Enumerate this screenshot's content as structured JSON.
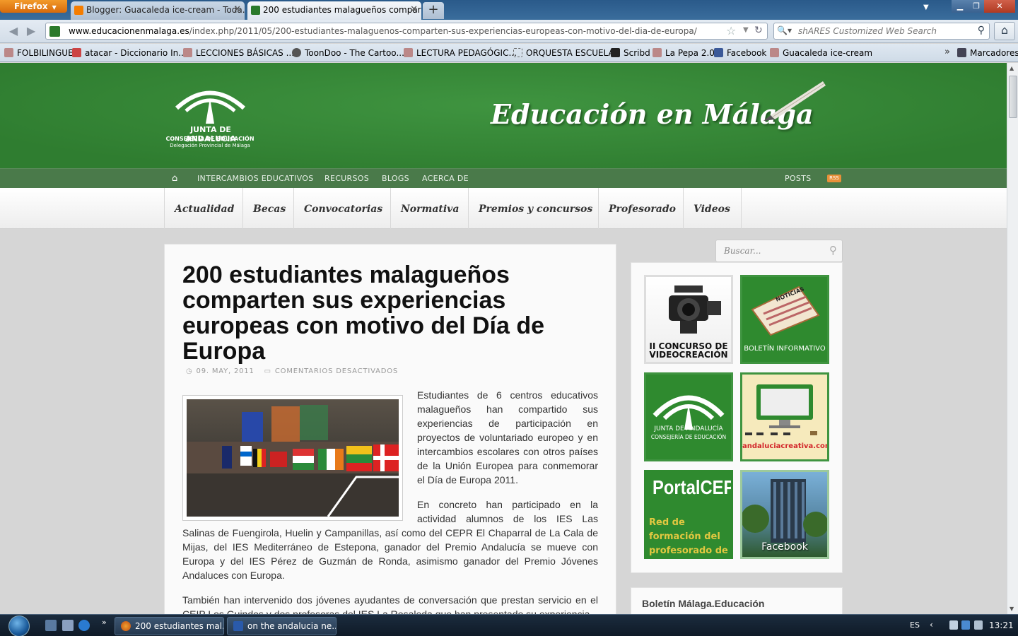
{
  "browser": {
    "menu_button": "Firefox",
    "tabs": [
      {
        "label": "Blogger: Guacaleda ice-cream - Toda...",
        "active": false
      },
      {
        "label": "200 estudiantes malagueños compart...",
        "active": true
      }
    ],
    "url_domain": "www.educacionenmalaga.es",
    "url_path": "/index.php/2011/05/200-estudiantes-malaguenos-comparten-sus-experiencias-europeas-con-motivo-del-dia-de-europa/",
    "search_placeholder": "shARES Customized Web Search",
    "bookmarks": [
      "FOLBILINGUE",
      "atacar - Diccionario In...",
      "LECCIONES BÁSICAS ...",
      "ToonDoo - The Cartoo...",
      "LECTURA PEDAGÓGIC...",
      "ORQUESTA ESCUELA",
      "Scribd",
      "La Pepa 2.0",
      "Facebook",
      "Guacaleda ice-cream"
    ],
    "bookmarks_menu": "Marcadores"
  },
  "site": {
    "logo": {
      "line1": "JUNTA DE ANDALUCIA",
      "line2": "CONSEJERÍA DE EDUCACIÓN",
      "line3": "Delegación Provincial de Málaga"
    },
    "title": "Educación en Málaga",
    "topnav": [
      "INTERCAMBIOS EDUCATIVOS",
      "RECURSOS",
      "BLOGS",
      "ACERCA DE"
    ],
    "posts_link": "POSTS",
    "rss": "RSS",
    "categories": [
      "Actualidad",
      "Becas",
      "Convocatorias",
      "Normativa",
      "Premios y concursos",
      "Profesorado",
      "Videos"
    ]
  },
  "post": {
    "title": "200 estudiantes malagueños comparten sus experiencias europeas con motivo del Día de Europa",
    "date": "09. MAY, 2011",
    "comments": "COMENTARIOS DESACTIVADOS",
    "paragraphs": [
      "Estudiantes de 6 centros educativos malagueños han compartido sus experiencias de participación en proyectos de voluntariado europeo y en intercambios escolares con otros países de la Unión Europea para conmemorar el Día de Europa 2011.",
      "En concreto han participado en la actividad alumnos de los IES Las Salinas de Fuengirola, Huelin y Campanillas, así como del CEPR El Chaparral de La Cala de Mijas, del IES Mediterráneo de Estepona, ganador del Premio Andalucía se mueve con Europa y del IES Pérez de Guzmán de Ronda, asimismo ganador del Premio Jóvenes Andaluces con Europa.",
      "También han intervenido dos jóvenes ayudantes de conversación que prestan servicio en el CEIP Los Guindos y dos profesoras del IES La Rosaleda que han presentado su experiencia"
    ]
  },
  "sidebar": {
    "search_placeholder": "Buscar...",
    "banners": {
      "video": "II CONCURSO DE VIDEOCREACIÓN",
      "boletin": "BOLETÍN INFORMATIVO",
      "boletin_paper": "NOTICIAS",
      "junta_line1": "JUNTA DE ANDALUCÍA",
      "junta_line2": "CONSEJERÍA DE EDUCACIÓN",
      "andcreativa": "andaluciacreativa.com",
      "portalcep_title": "PortalCEP",
      "portalcep_sub": "Red de formación del profesorado de Málaga",
      "facebook": "Facebook"
    },
    "boletin_widget_title": "Boletín Málaga.Educación"
  },
  "taskbar": {
    "tasks": [
      "200 estudiantes mal...",
      "on the andalucia ne..."
    ],
    "language": "ES",
    "clock": "13:21"
  }
}
